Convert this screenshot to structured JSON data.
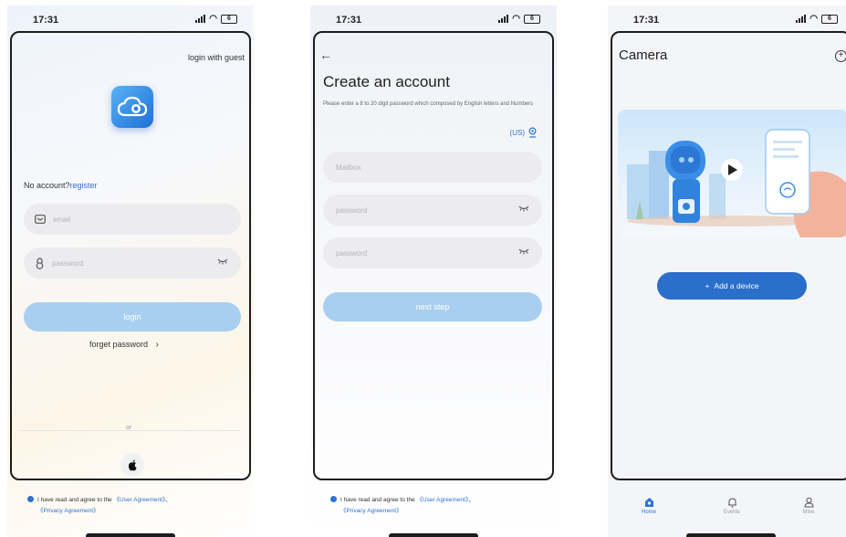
{
  "status_bar": {
    "time": "17:31",
    "battery": "6"
  },
  "login_screen": {
    "guest_link": "login with guest",
    "no_account_text": "No account?",
    "register_link": "register",
    "email_placeholder": "email",
    "password_placeholder": "password",
    "login_button": "login",
    "forget_password": "forget password",
    "or_divider": "or",
    "agreement_prefix": "I have read and agree to the",
    "user_agreement": "《User Agreement》",
    "separator": "、",
    "privacy_agreement": "《Privacy Agreement》"
  },
  "register_screen": {
    "title": "Create an account",
    "hint": "Please enter a 8 to 20 digit password which composed by English letters and Numbers",
    "region": "(US)",
    "mailbox_placeholder": "Mailbox",
    "password_placeholder": "password",
    "confirm_password_placeholder": "password",
    "next_button": "next step",
    "agreement_prefix": "I have read and agree to the",
    "user_agreement": "《User Agreement》",
    "separator": "、",
    "privacy_agreement": "《Privacy Agreement》"
  },
  "camera_screen": {
    "title": "Camera",
    "add_device_button": "Add a device",
    "tabs": [
      {
        "label": "Home",
        "icon": "home-icon",
        "active": true
      },
      {
        "label": "Events",
        "icon": "bell-icon",
        "active": false
      },
      {
        "label": "Mine",
        "icon": "person-icon",
        "active": false
      }
    ]
  },
  "colors": {
    "accent": "#2e73d6",
    "button_disabled": "#a9cff0",
    "add_button": "#2a6fc9"
  }
}
